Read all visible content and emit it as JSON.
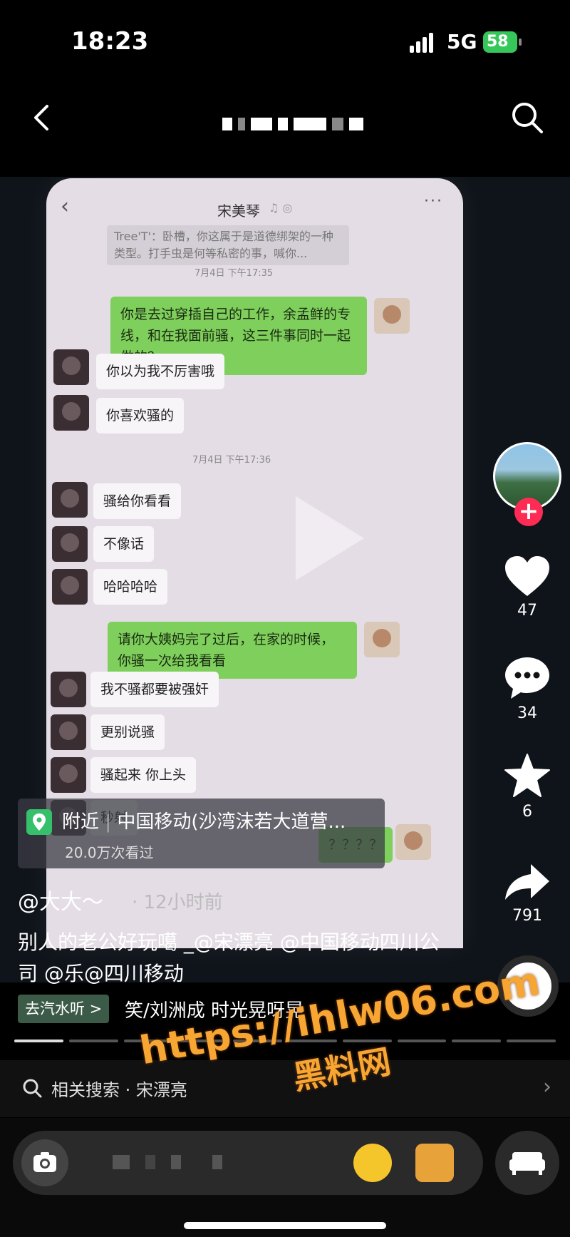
{
  "status_bar": {
    "time": "18:23",
    "network": "5G",
    "battery": "58"
  },
  "top_nav": {
    "back_icon": "chevron-left-icon",
    "search_icon": "search-icon"
  },
  "chat": {
    "contact_name": "宋美琴",
    "quote_text": "Tree'T'：卧槽，你这属于是道德绑架的一种类型。打手虫是何等私密的事，喊你...",
    "timestamps": [
      "7月4日 下午17:35",
      "7月4日 下午17:36"
    ],
    "messages": [
      {
        "side": "me",
        "text": "你是去过穿插自己的工作，余孟鲜的专线，和在我面前骚，这三件事同时一起做的？"
      },
      {
        "side": "them",
        "text": "你以为我不厉害哦"
      },
      {
        "side": "them",
        "text": "你喜欢骚的"
      },
      {
        "side": "them",
        "text": "骚给你看看"
      },
      {
        "side": "them",
        "text": "不像话"
      },
      {
        "side": "them",
        "text": "哈哈哈哈"
      },
      {
        "side": "me",
        "text": "请你大姨妈完了过后，在家的时候，你骚一次给我看看"
      },
      {
        "side": "them",
        "text": "我不骚都要被强奸"
      },
      {
        "side": "them",
        "text": "更别说骚"
      },
      {
        "side": "them",
        "text": "骚起来 你上头"
      },
      {
        "side": "them",
        "text": "秒射"
      },
      {
        "side": "me",
        "text": "？？？？"
      }
    ]
  },
  "sidebar": {
    "likes": "47",
    "comments": "34",
    "favorites": "6",
    "shares": "791"
  },
  "location": {
    "label": "附近",
    "name": "中国移动(沙湾沫若大道营...",
    "views": "20.0万次看过"
  },
  "post": {
    "author": "@大大～",
    "time": "· 12小时前",
    "caption": "别人的老公好玩噶 _@宋漂亮 @中国移动四川公司 @乐@四川移动",
    "music_chip": "去汽水听 >",
    "music_title": "笑/刘洲成     时光晃呀晃"
  },
  "related": {
    "label": "相关搜索 · 宋漂亮"
  },
  "watermark": {
    "url": "https://ihlw06.com",
    "name": "黑料网"
  },
  "colors": {
    "accent_red": "#fe2c55",
    "bubble_green": "#7ecf5c",
    "watermark_orange": "#f7a633",
    "location_green": "#36c06b"
  }
}
